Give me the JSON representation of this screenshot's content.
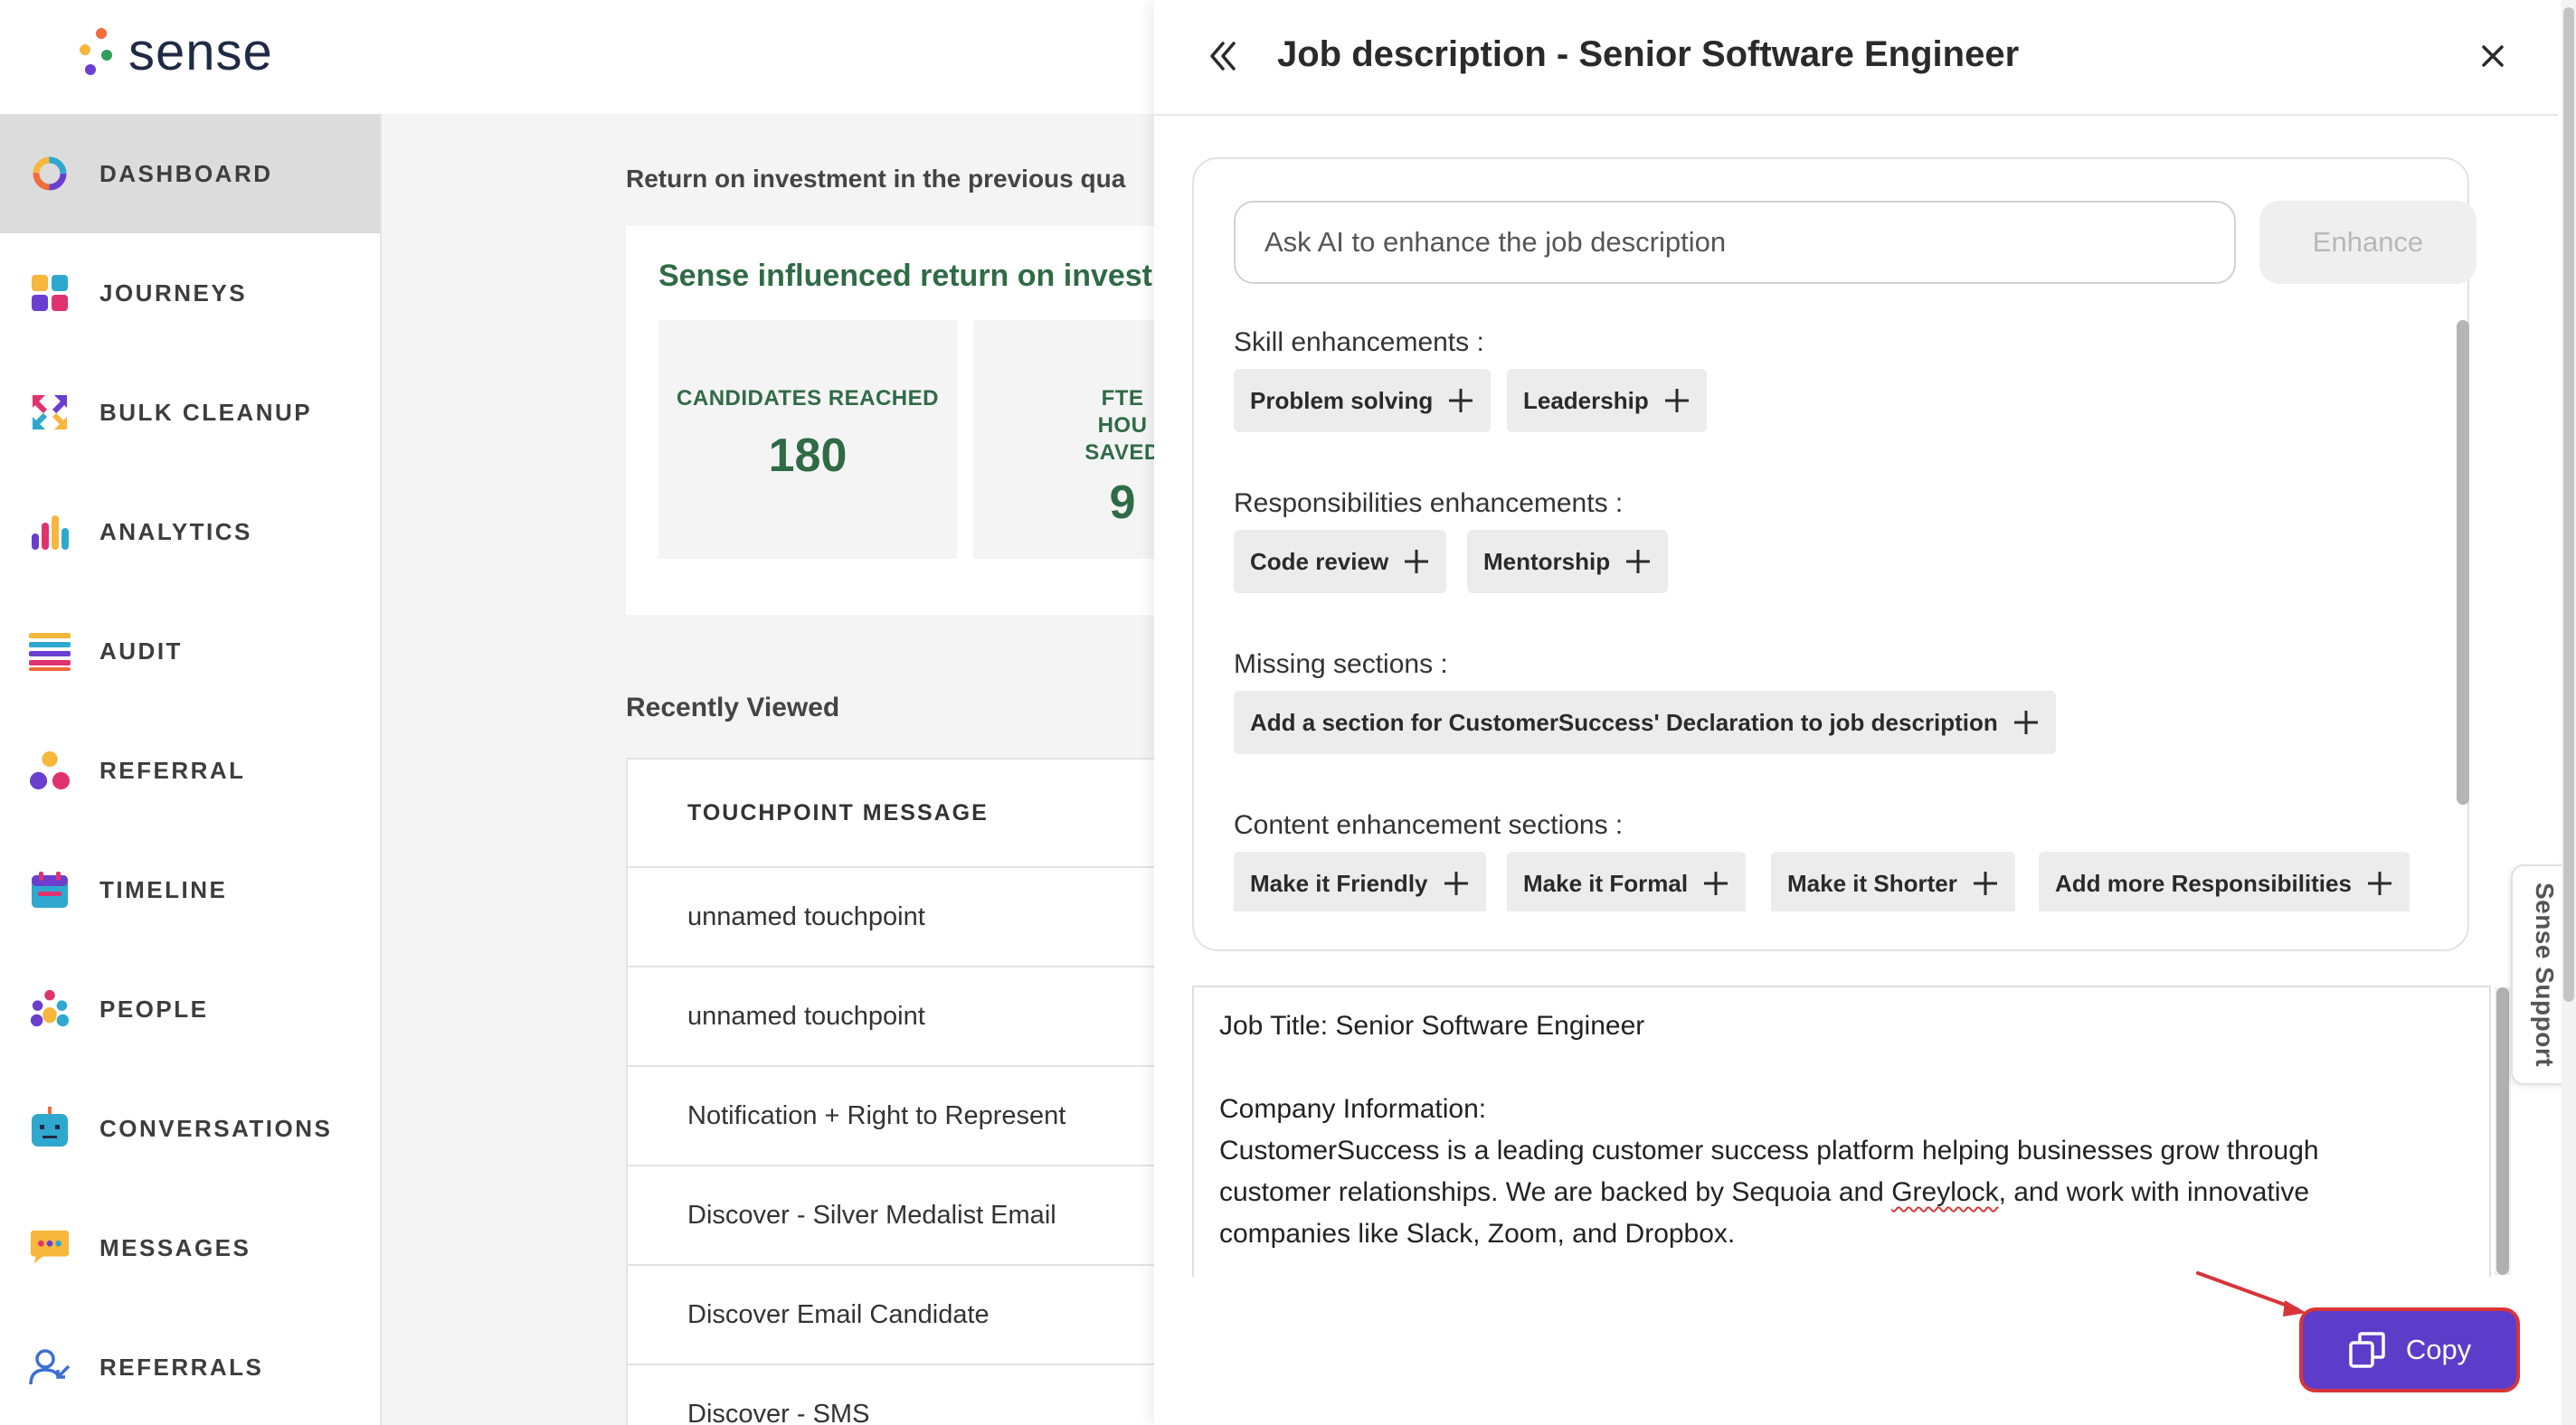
{
  "app": {
    "name": "sense"
  },
  "colors": {
    "accent": "#5b3dc9",
    "brand_green": "#2f6b45",
    "highlight_red": "#d9343a"
  },
  "sidebar": {
    "items": [
      {
        "label": "DASHBOARD",
        "icon": "dashboard-ring-icon",
        "active": true
      },
      {
        "label": "JOURNEYS",
        "icon": "journeys-grid-icon"
      },
      {
        "label": "BULK CLEANUP",
        "icon": "bulk-cleanup-arrows-icon"
      },
      {
        "label": "ANALYTICS",
        "icon": "analytics-bars-icon"
      },
      {
        "label": "AUDIT",
        "icon": "audit-list-icon"
      },
      {
        "label": "REFERRAL",
        "icon": "referral-nodes-icon"
      },
      {
        "label": "TIMELINE",
        "icon": "timeline-calendar-icon"
      },
      {
        "label": "PEOPLE",
        "icon": "people-group-icon"
      },
      {
        "label": "CONVERSATIONS",
        "icon": "conversations-bot-icon"
      },
      {
        "label": "MESSAGES",
        "icon": "messages-bubble-icon"
      },
      {
        "label": "REFERRALS",
        "icon": "referrals-user-icon"
      }
    ]
  },
  "main": {
    "roi_title": "Return on investment in the previous qua",
    "roi_heading": "Sense influenced return on investr",
    "stats": [
      {
        "label": "CANDIDATES REACHED",
        "value": "180"
      },
      {
        "label": "FTE HOU SAVED",
        "value": "9"
      }
    ],
    "recent_title": "Recently Viewed",
    "table_header": "TOUCHPOINT MESSAGE",
    "rows": [
      "unnamed touchpoint",
      "unnamed touchpoint",
      "Notification + Right to Represent",
      "Discover - Silver Medalist Email",
      "Discover Email Candidate",
      "Discover - SMS"
    ]
  },
  "drawer": {
    "title": "Job description - Senior Software Engineer",
    "ai_placeholder": "Ask AI to enhance the job description",
    "enhance_label": "Enhance",
    "sections": [
      {
        "title": "Skill enhancements :",
        "chips": [
          "Problem solving",
          "Leadership"
        ]
      },
      {
        "title": "Responsibilities enhancements :",
        "chips": [
          "Code review",
          "Mentorship"
        ]
      },
      {
        "title": "Missing sections :",
        "chips": [
          "Add a section for CustomerSuccess' Declaration to job description"
        ]
      },
      {
        "title": "Content enhancement sections :",
        "chips": [
          "Make it Friendly",
          "Make it Formal",
          "Make it Shorter",
          "Add more Responsibilities"
        ]
      }
    ],
    "jd": {
      "title_line": "Job Title: Senior Software Engineer",
      "company_heading": "Company Information:",
      "company_before": "CustomerSuccess is a leading customer success platform helping businesses grow through customer relationships. We are backed by Sequoia and ",
      "company_flagged": "Greylock",
      "company_after": ", and work with innovative companies like Slack, Zoom, and Dropbox."
    },
    "copy_label": "Copy"
  },
  "support_tab": {
    "label": "Sense Support"
  }
}
